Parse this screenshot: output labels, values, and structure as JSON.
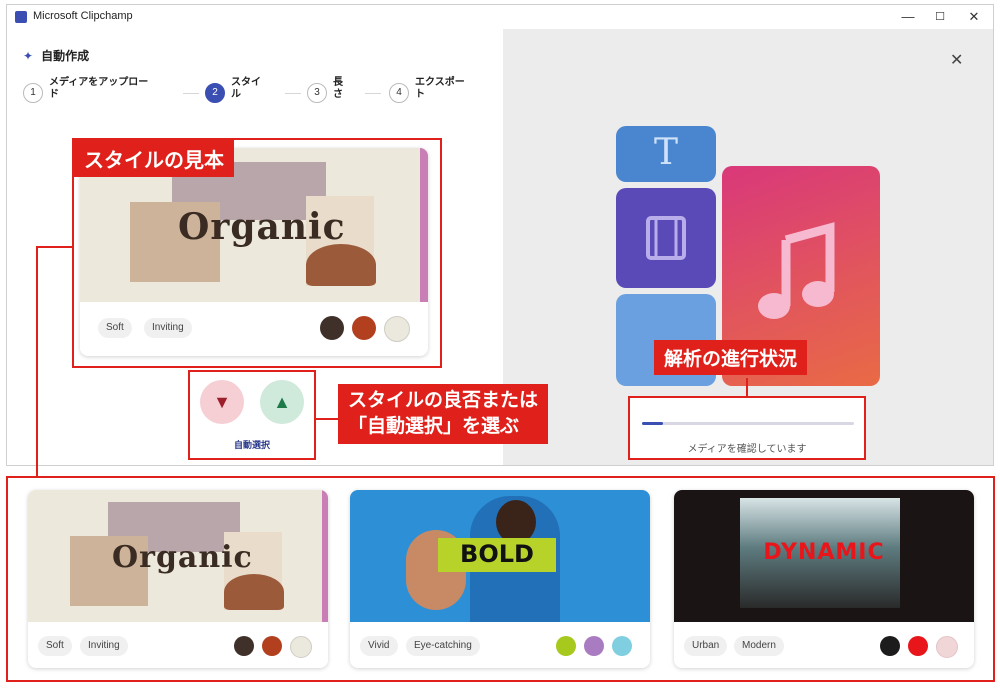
{
  "window": {
    "title": "Microsoft Clipchamp",
    "controls": {
      "minimize": "—",
      "maximize": "☐",
      "close": "✕"
    }
  },
  "wizard": {
    "title": "自動作成",
    "steps": [
      {
        "num": "1",
        "label": "メディアをアップロー\nド"
      },
      {
        "num": "2",
        "label": "スタイ\nル"
      },
      {
        "num": "3",
        "label": "長\nさ"
      },
      {
        "num": "4",
        "label": "エクスポー\nト"
      }
    ]
  },
  "preview_card": {
    "artwork_text": "Organic",
    "tags": [
      "Soft",
      "Inviting"
    ],
    "swatches": [
      "#3f302a",
      "#b2401f",
      "#ebe8de"
    ]
  },
  "feedback": {
    "dislike_icon": "thumbs-down-icon",
    "like_icon": "thumbs-up-icon",
    "auto_select_label": "自動選択"
  },
  "analysis": {
    "icons": [
      "text-icon",
      "film-icon",
      "image-icon",
      "music-note-icon"
    ],
    "text_tile_glyph": "T",
    "progress": 0.1,
    "status_text": "メディアを確認しています"
  },
  "callouts": {
    "style_sample": "スタイルの見本",
    "analysis_progress": "解析の進行状況",
    "choose_style_line1": "スタイルの良否または",
    "choose_style_line2": "「自動選択」を選ぶ"
  },
  "style_options": [
    {
      "artwork_text": "Organic",
      "tags": [
        "Soft",
        "Inviting"
      ],
      "swatches": [
        "#3f302a",
        "#b2401f",
        "#ebe8de"
      ]
    },
    {
      "artwork_text": "BOLD",
      "tags": [
        "Vivid",
        "Eye-catching"
      ],
      "swatches": [
        "#a7c81c",
        "#a97cc2",
        "#80cfe0"
      ]
    },
    {
      "artwork_text": "DYNAMIC",
      "tags": [
        "Urban",
        "Modern"
      ],
      "swatches": [
        "#1c1c1c",
        "#e8161a",
        "#f1d6d8"
      ]
    }
  ],
  "colors": {
    "accent": "#3b4fb3",
    "callout_red": "#e0211b"
  }
}
